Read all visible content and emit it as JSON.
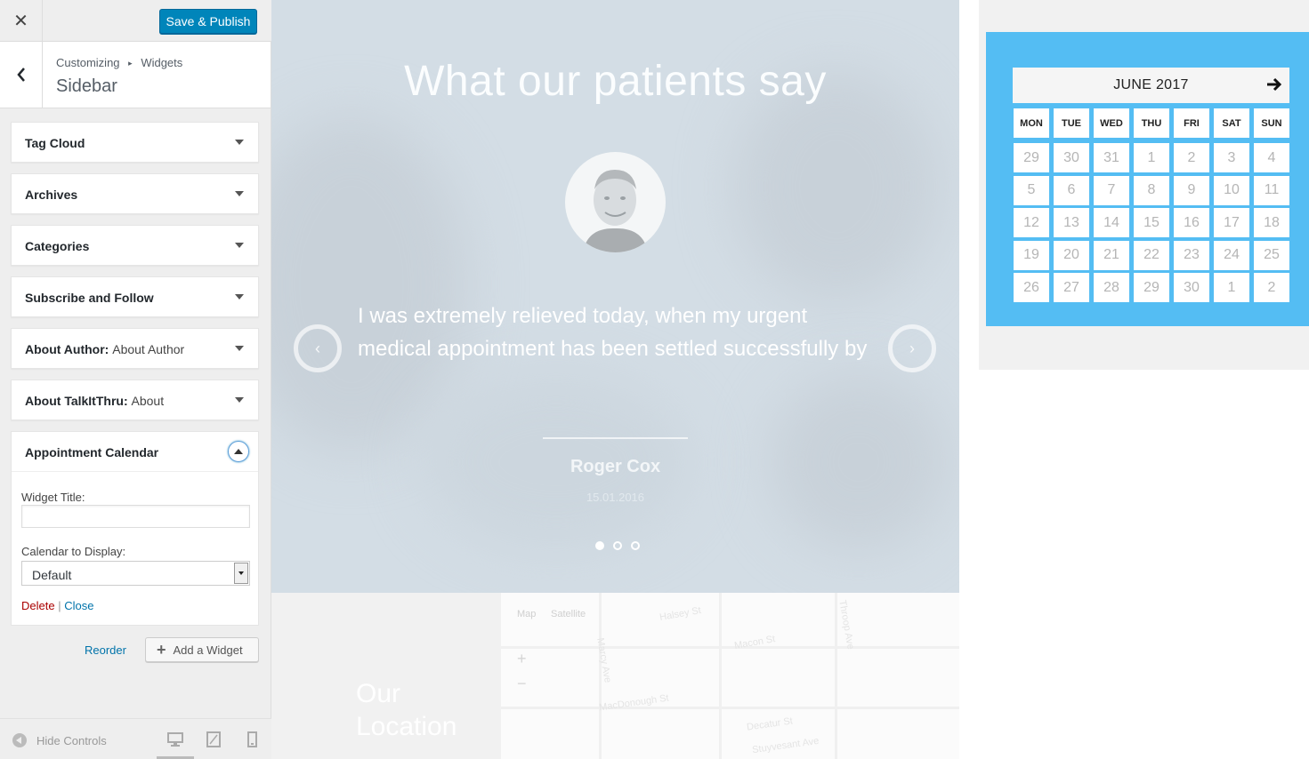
{
  "topbar": {
    "close_label": "✕",
    "save_label": "Save & Publish"
  },
  "section": {
    "breadcrumb_parent": "Customizing",
    "breadcrumb_sep": "▸",
    "breadcrumb_child": "Widgets",
    "title": "Sidebar"
  },
  "widgets": [
    {
      "title": "Tag Cloud",
      "instance": ""
    },
    {
      "title": "Archives",
      "instance": ""
    },
    {
      "title": "Categories",
      "instance": ""
    },
    {
      "title": "Subscribe and Follow",
      "instance": ""
    },
    {
      "title": "About Author:",
      "instance": "About Author"
    },
    {
      "title": "About TalkItThru:",
      "instance": "About"
    }
  ],
  "open_widget": {
    "title": "Appointment Calendar",
    "widget_title_label": "Widget Title:",
    "widget_title_value": "",
    "calendar_label": "Calendar to Display:",
    "calendar_value": "Default",
    "delete_label": "Delete",
    "separator": "|",
    "close_label": "Close"
  },
  "panel_actions": {
    "reorder_label": "Reorder",
    "add_label": "Add a Widget"
  },
  "footer": {
    "hide_label": "Hide Controls"
  },
  "hero": {
    "title": "What our patients say",
    "quote": "I was extremely relieved today, when my urgent medical appointment has been settled successfully by",
    "author": "Roger Cox",
    "date": "15.01.2016",
    "prev_label": "‹",
    "next_label": "›"
  },
  "location": {
    "title_line1": "Our",
    "title_line2": "Location"
  },
  "map": {
    "tab_map": "Map",
    "tab_satellite": "Satellite",
    "zoom_in": "+",
    "zoom_out": "−",
    "streets": [
      "Halsey St",
      "Macon St",
      "MacDonough St",
      "Throop Ave",
      "Marcy Ave",
      "Decatur St",
      "Stuyvesant Ave"
    ]
  },
  "calendar": {
    "month_title": "JUNE 2017",
    "weekdays": [
      "MON",
      "TUE",
      "WED",
      "THU",
      "FRI",
      "SAT",
      "SUN"
    ],
    "weeks": [
      [
        "29",
        "30",
        "31",
        "1",
        "2",
        "3",
        "4"
      ],
      [
        "5",
        "6",
        "7",
        "8",
        "9",
        "10",
        "11"
      ],
      [
        "12",
        "13",
        "14",
        "15",
        "16",
        "17",
        "18"
      ],
      [
        "19",
        "20",
        "21",
        "22",
        "23",
        "24",
        "25"
      ],
      [
        "26",
        "27",
        "28",
        "29",
        "30",
        "1",
        "2"
      ]
    ]
  },
  "colors": {
    "primary": "#0085ba",
    "calendar_bg": "#54bdf3",
    "delete": "#a00",
    "link": "#0073aa"
  }
}
